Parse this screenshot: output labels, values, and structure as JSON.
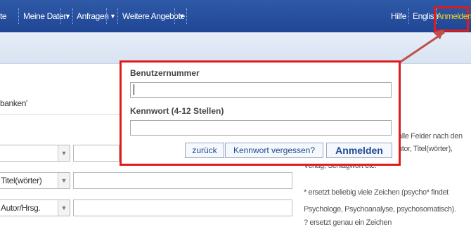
{
  "nav": {
    "items": [
      {
        "label": "te"
      },
      {
        "label": "Meine Daten"
      },
      {
        "label": "Anfragen"
      },
      {
        "label": "Weitere Angebote"
      }
    ],
    "help": "Hilfe",
    "language": "English",
    "login": "Anmelden"
  },
  "background": {
    "section_title": "banken'",
    "rows": [
      {
        "select_label": ""
      },
      {
        "select_label": "Titel(wörter)"
      },
      {
        "select_label": "Autor/Hrsg."
      }
    ],
    "help_lines_1": [
      "alle Felder nach den",
      "utor, Titel(wörter),",
      "Verlag, Schlagwort etc."
    ],
    "help_lines_2": [
      "* ersetzt beliebig viele Zeichen (psycho* findet",
      "Psychologe, Psychoanalyse, psychosomatisch).",
      "? ersetzt genau ein Zeichen"
    ]
  },
  "login_popup": {
    "user_label": "Benutzernummer",
    "user_value": "",
    "password_label": "Kennwort (4-12 Stellen)",
    "password_value": "",
    "back_button": "zurück",
    "forgot_button": "Kennwort vergessen?",
    "submit_button": "Anmelden"
  },
  "colors": {
    "nav_bg": "#1f4694",
    "login_text": "#f3d22b",
    "highlight": "#e01b1b"
  }
}
